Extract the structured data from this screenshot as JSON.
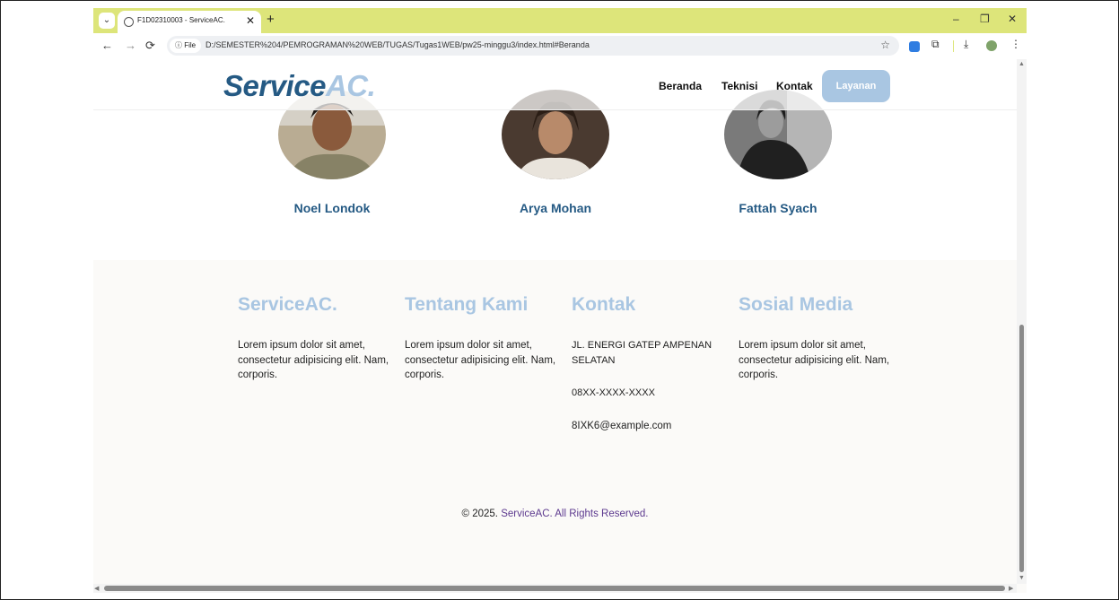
{
  "browser": {
    "tab_title": "F1D02310003 - ServiceAC.",
    "tab_close": "✕",
    "new_tab": "+",
    "file_label": "File",
    "url": "D:/SEMESTER%204/PEMROGRAMAN%20WEB/TUGAS/Tugas1WEB/pw25-minggu3/index.html#Beranda",
    "window_controls": {
      "minimize": "–",
      "restore": "❐",
      "close": "✕"
    },
    "nav_icons": {
      "back": "←",
      "forward": "→",
      "reload": "⟳"
    },
    "toolbar_icons": {
      "star": "☆",
      "extensions": "⧉",
      "download": "⤓",
      "menu": "⋮"
    }
  },
  "site": {
    "logo_main": "Service",
    "logo_accent": "AC.",
    "nav": [
      "Beranda",
      "Teknisi",
      "Kontak"
    ],
    "nav_button": "Layanan",
    "team": [
      {
        "name": "Noel Londok"
      },
      {
        "name": "Arya Mohan"
      },
      {
        "name": "Fattah Syach"
      }
    ],
    "footer": {
      "columns": [
        {
          "title": "ServiceAC.",
          "text": "Lorem ipsum dolor sit amet, consectetur adipisicing elit. Nam, corporis."
        },
        {
          "title": "Tentang Kami",
          "text": "Lorem ipsum dolor sit amet, consectetur adipisicing elit. Nam, corporis."
        },
        {
          "title": "Kontak",
          "address": "JL. ENERGI GATEP AMPENAN SELATAN",
          "phone": "08XX-XXXX-XXXX",
          "email": "8IXK6@example.com"
        },
        {
          "title": "Sosial Media",
          "text": "Lorem ipsum dolor sit amet, consectetur adipisicing elit. Nam, corporis."
        }
      ],
      "copyright_prefix": "© 2025.",
      "copyright_brand": "ServiceAC. All Rights Reserved."
    }
  },
  "colors": {
    "browser_frame": "#dde57a",
    "brand_dark": "#255a84",
    "brand_light": "#a9c6e2",
    "copyright_brand": "#5d3a8f"
  }
}
